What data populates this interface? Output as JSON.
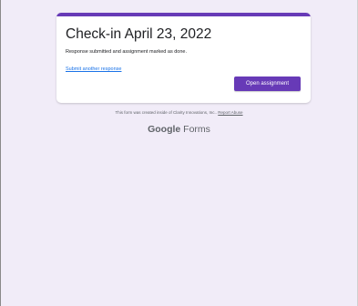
{
  "colors": {
    "page_background": "#f1ecf8",
    "accent": "#673ab7",
    "link": "#1a73e8",
    "text_primary": "#202124",
    "text_secondary": "#5f6368"
  },
  "card": {
    "title": "Check-in April 23, 2022",
    "message": "Response submitted and assignment marked as done.",
    "submit_another_link": "Submit another response",
    "open_assignment_button": "Open assignment"
  },
  "footer": {
    "created_text": "This form was created inside of Clarity Innovations, Inc..",
    "report_abuse_link": "Report Abuse"
  },
  "brand": {
    "google": "Google",
    "forms": "Forms"
  }
}
